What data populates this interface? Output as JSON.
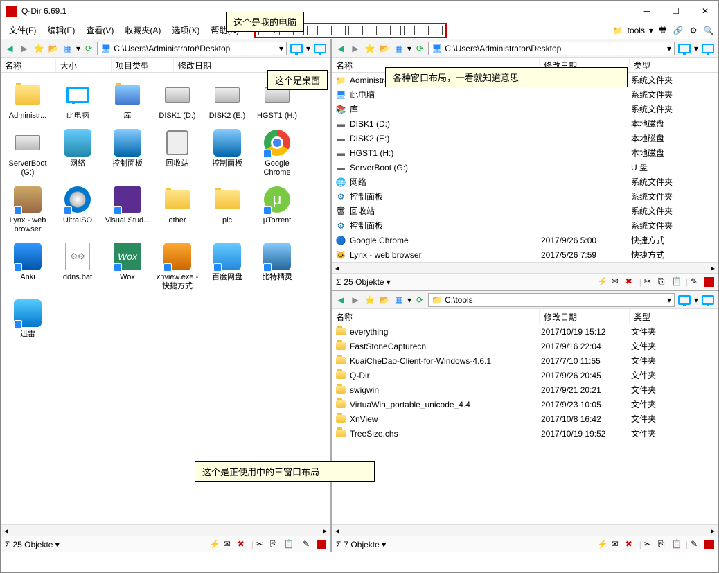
{
  "window": {
    "title": "Q-Dir 6.69.1"
  },
  "menu": {
    "file": "文件(F)",
    "edit": "编辑(E)",
    "view": "查看(V)",
    "fav": "收藏夹(A)",
    "opt": "选项(X)",
    "help": "帮助(N)",
    "tools": "tools"
  },
  "annotations": {
    "a1": "这个是我的电脑",
    "a2": "这个是桌面",
    "a3": "各种窗口布局，一看就知道意思",
    "a4": "这个是正使用中的三窗口布局"
  },
  "pane1": {
    "path": "C:\\Users\\Administrator\\Desktop",
    "cols": {
      "name": "名称",
      "size": "大小",
      "type": "项目类型",
      "date": "修改日期"
    },
    "status": "25 Objekte",
    "items": [
      {
        "label": "Administr...",
        "icon": "folder-user",
        "shortcut": false
      },
      {
        "label": "此电脑",
        "icon": "computer",
        "shortcut": false
      },
      {
        "label": "库",
        "icon": "library",
        "shortcut": false
      },
      {
        "label": "DISK1 (D:)",
        "icon": "disk",
        "shortcut": false
      },
      {
        "label": "DISK2 (E:)",
        "icon": "disk",
        "shortcut": false
      },
      {
        "label": "HGST1 (H:)",
        "icon": "disk",
        "shortcut": false
      },
      {
        "label": "ServerBoot (G:)",
        "icon": "disk",
        "shortcut": false
      },
      {
        "label": "网络",
        "icon": "network",
        "shortcut": false
      },
      {
        "label": "控制面板",
        "icon": "cpanel",
        "shortcut": false
      },
      {
        "label": "回收站",
        "icon": "recycle",
        "shortcut": false
      },
      {
        "label": "控制面板",
        "icon": "cpanel",
        "shortcut": false
      },
      {
        "label": "Google Chrome",
        "icon": "chrome",
        "shortcut": true
      },
      {
        "label": "Lynx - web browser",
        "icon": "lynx",
        "shortcut": true
      },
      {
        "label": "UltraISO",
        "icon": "ultraiso",
        "shortcut": true
      },
      {
        "label": "Visual Stud...",
        "icon": "vs",
        "shortcut": true
      },
      {
        "label": "other",
        "icon": "folder",
        "shortcut": false
      },
      {
        "label": "pic",
        "icon": "folder",
        "shortcut": false
      },
      {
        "label": "μTorrent",
        "icon": "utorrent",
        "shortcut": true
      },
      {
        "label": "Anki",
        "icon": "anki",
        "shortcut": true
      },
      {
        "label": "ddns.bat",
        "icon": "bat",
        "shortcut": false
      },
      {
        "label": "Wox",
        "icon": "wox",
        "shortcut": true
      },
      {
        "label": "xnview.exe - 快捷方式",
        "icon": "xnview",
        "shortcut": true
      },
      {
        "label": "百度网盘",
        "icon": "baidu",
        "shortcut": true
      },
      {
        "label": "比特精灵",
        "icon": "bitspirit",
        "shortcut": true
      },
      {
        "label": "迅雷",
        "icon": "xunlei",
        "shortcut": true
      }
    ]
  },
  "pane2": {
    "path": "C:\\Users\\Administrator\\Desktop",
    "cols": {
      "name": "名称",
      "date": "修改日期",
      "type": "类型"
    },
    "status": "25 Objekte",
    "items": [
      {
        "name": "Administrator",
        "date": "",
        "type": "系统文件夹",
        "icon": "folder-user"
      },
      {
        "name": "此电脑",
        "date": "",
        "type": "系统文件夹",
        "icon": "computer"
      },
      {
        "name": "库",
        "date": "",
        "type": "系统文件夹",
        "icon": "library"
      },
      {
        "name": "DISK1 (D:)",
        "date": "",
        "type": "本地磁盘",
        "icon": "disk"
      },
      {
        "name": "DISK2 (E:)",
        "date": "",
        "type": "本地磁盘",
        "icon": "disk"
      },
      {
        "name": "HGST1 (H:)",
        "date": "",
        "type": "本地磁盘",
        "icon": "disk"
      },
      {
        "name": "ServerBoot (G:)",
        "date": "",
        "type": "U 盘",
        "icon": "usb"
      },
      {
        "name": "网络",
        "date": "",
        "type": "系统文件夹",
        "icon": "network"
      },
      {
        "name": "控制面板",
        "date": "",
        "type": "系统文件夹",
        "icon": "cpanel"
      },
      {
        "name": "回收站",
        "date": "",
        "type": "系统文件夹",
        "icon": "recycle"
      },
      {
        "name": "控制面板",
        "date": "",
        "type": "系统文件夹",
        "icon": "cpanel"
      },
      {
        "name": "Google Chrome",
        "date": "2017/9/26 5:00",
        "type": "快捷方式",
        "icon": "chrome"
      },
      {
        "name": "Lynx - web browser",
        "date": "2017/5/26 7:59",
        "type": "快捷方式",
        "icon": "lynx"
      }
    ]
  },
  "pane3": {
    "path": "C:\\tools",
    "cols": {
      "name": "名称",
      "date": "修改日期",
      "type": "类型"
    },
    "status": "7 Objekte",
    "items": [
      {
        "name": "everything",
        "date": "2017/10/19 15:12",
        "type": "文件夹",
        "icon": "folder"
      },
      {
        "name": "FastStoneCapturecn",
        "date": "2017/9/16 22:04",
        "type": "文件夹",
        "icon": "folder"
      },
      {
        "name": "KuaiCheDao-Client-for-Windows-4.6.1",
        "date": "2017/7/10 11:55",
        "type": "文件夹",
        "icon": "folder"
      },
      {
        "name": "Q-Dir",
        "date": "2017/9/26 20:45",
        "type": "文件夹",
        "icon": "folder"
      },
      {
        "name": "swigwin",
        "date": "2017/9/21 20:21",
        "type": "文件夹",
        "icon": "folder"
      },
      {
        "name": "VirtuaWin_portable_unicode_4.4",
        "date": "2017/9/23 10:05",
        "type": "文件夹",
        "icon": "folder"
      },
      {
        "name": "XnView",
        "date": "2017/10/8 16:42",
        "type": "文件夹",
        "icon": "folder"
      },
      {
        "name": "TreeSize.chs",
        "date": "2017/10/19 19:52",
        "type": "文件夹",
        "icon": "folder"
      }
    ]
  },
  "sigma": "Σ"
}
